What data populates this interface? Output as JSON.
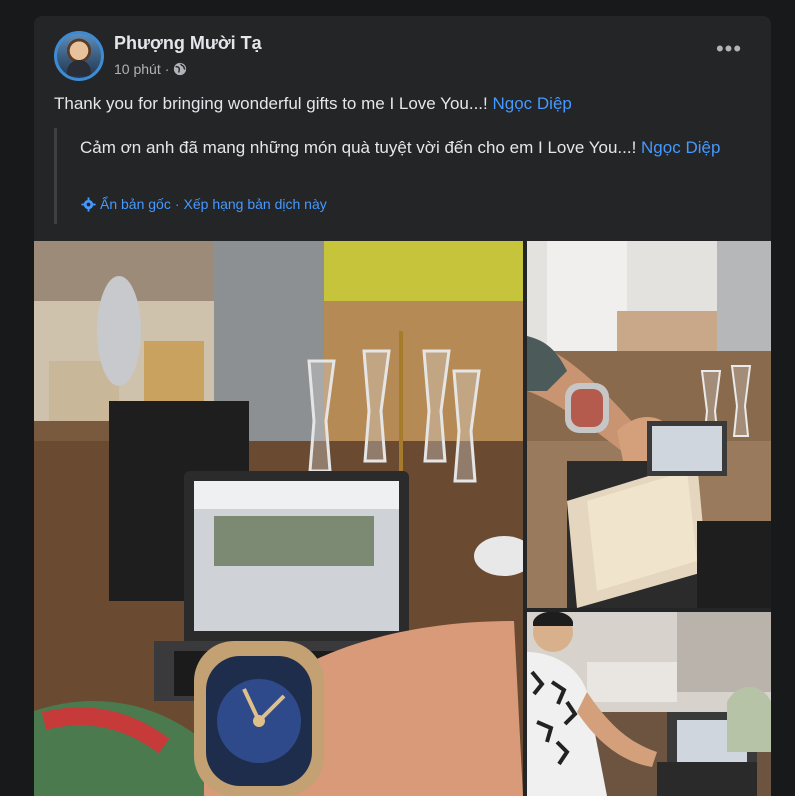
{
  "post": {
    "author": "Phượng Mười Tạ",
    "time": "10 phút",
    "separator": "·",
    "privacy_icon": "globe-icon",
    "more_icon": "more-options-icon",
    "text": "Thank you for bringing wonderful gifts to me I Love You...! ",
    "mention": "Ngọc Diệp",
    "original_text": "Cảm ơn anh đã mang những món quà tuyệt vời đến cho em I Love You...! ",
    "original_mention": "Ngọc Diệp",
    "hide_original": "Ẩn bản gốc",
    "translate_separator": "·",
    "rate_translation": "Xếp hạng bản dịch này"
  },
  "photos": [
    {
      "name": "watch-on-wrist-with-laptop-photo",
      "description_icon": "image"
    },
    {
      "name": "opening-watch-box-photo",
      "description_icon": "image"
    },
    {
      "name": "man-unboxing-photo",
      "description_icon": "image"
    }
  ],
  "colors": {
    "background": "#18191a",
    "card": "#242526",
    "text": "#e4e6eb",
    "secondary": "#b0b3b8",
    "link": "#4599ff",
    "avatar_ring": "#3e8bd3"
  }
}
